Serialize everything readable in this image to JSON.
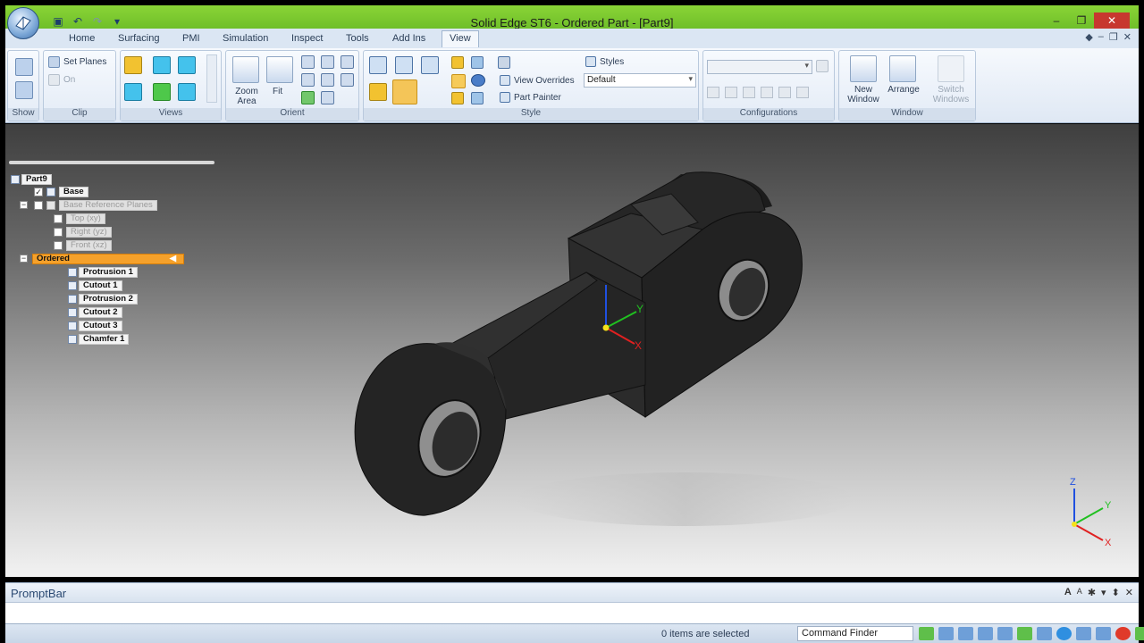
{
  "window": {
    "title": "Solid Edge ST6 - Ordered Part - [Part9]",
    "controls": [
      "–",
      "❐",
      "✕"
    ]
  },
  "quick_access": [
    "save-icon",
    "undo-icon",
    "redo-icon",
    "dropdown-icon"
  ],
  "tabs": [
    "Home",
    "Surfacing",
    "PMI",
    "Simulation",
    "Inspect",
    "Tools",
    "Add Ins",
    "View"
  ],
  "active_tab": "View",
  "ribbon": {
    "show": {
      "label": "Show"
    },
    "clip": {
      "label": "Clip",
      "set_planes": "Set Planes",
      "on": "On"
    },
    "views": {
      "label": "Views"
    },
    "orient": {
      "label": "Orient",
      "zoom_area": "Zoom Area",
      "fit": "Fit"
    },
    "style": {
      "label": "Style",
      "view_overrides": "View Overrides",
      "part_painter": "Part Painter",
      "styles": "Styles",
      "style_value": "Default"
    },
    "configurations": {
      "label": "Configurations"
    },
    "window": {
      "label": "Window",
      "new_window": "New Window",
      "arrange": "Arrange",
      "switch_windows": "Switch Windows"
    }
  },
  "tree": {
    "root": "Part9",
    "base": "Base",
    "base_planes": "Base Reference Planes",
    "planes": [
      "Top (xy)",
      "Right (yz)",
      "Front (xz)"
    ],
    "ordered": "Ordered",
    "features": [
      "Protrusion 1",
      "Cutout 1",
      "Protrusion 2",
      "Cutout 2",
      "Cutout 3",
      "Chamfer 1"
    ]
  },
  "triad": {
    "x": "X",
    "y": "Y",
    "z": "Z"
  },
  "prompt_bar": {
    "title": "PromptBar",
    "controls": [
      "A",
      "A",
      "✱",
      "▾",
      "⬍",
      "✕"
    ]
  },
  "status": {
    "selection": "0 items are selected",
    "command_finder": "Command Finder"
  },
  "colors": {
    "title_bar": "#7cc832",
    "ordered_highlight": "#f5a12b",
    "part_body": "#2a2a2a",
    "axis_x": "#e02020",
    "axis_y": "#20c020",
    "axis_z": "#2050e0"
  }
}
